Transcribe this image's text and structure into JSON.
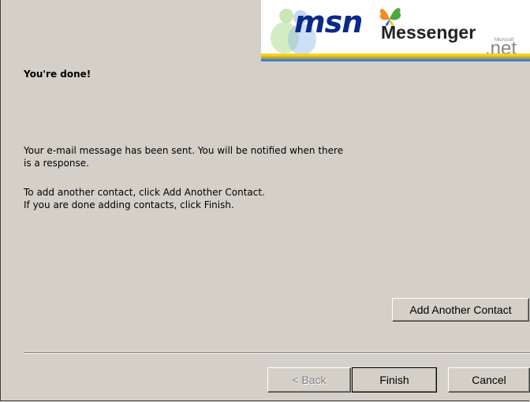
{
  "banner": {
    "brand": "msn",
    "product": "Messenger",
    "microsoft_small": "Microsoft",
    "net": ".net"
  },
  "page": {
    "title": "You're done!",
    "message_line1": "Your e-mail message has been sent. You will be notified when there",
    "message_line2": "is a response.",
    "instruction_line1": "To add another contact, click Add Another Contact.",
    "instruction_line2": "If you are done adding contacts, click Finish."
  },
  "buttons": {
    "add_another": "Add Another Contact",
    "back": "< Back",
    "finish": "Finish",
    "cancel": "Cancel"
  },
  "colors": {
    "dialog_bg": "#d4d0c8",
    "msn_blue": "#0a2a8a",
    "stripe_orange": "#f5a623",
    "stripe_yellow": "#f2d21a",
    "stripe_green": "#7ab648",
    "stripe_blue": "#4a7bd0"
  }
}
